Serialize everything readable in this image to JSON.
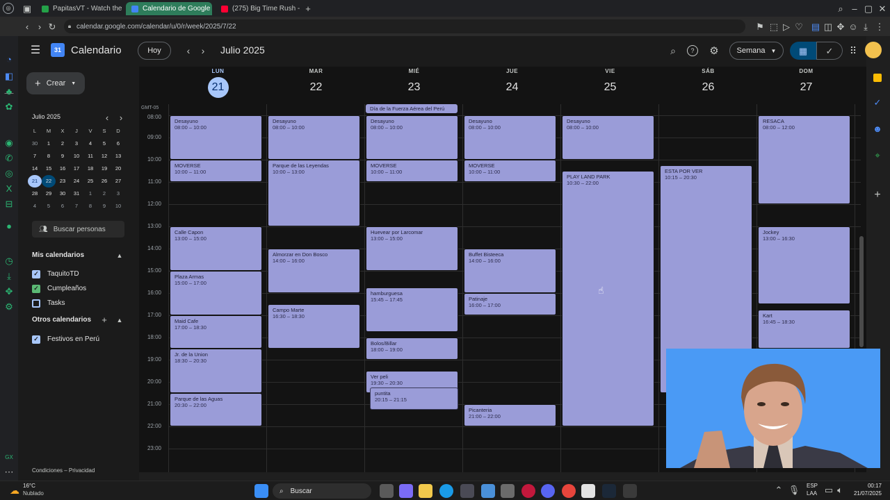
{
  "browser": {
    "tabs": [
      {
        "label": "PapitasVT - Watch the VO"
      },
      {
        "label": "Calendario de Google - S"
      },
      {
        "label": "(275) Big Time Rush -"
      }
    ],
    "url": "calendar.google.com/calendar/u/0/r/week/2025/7/22"
  },
  "header": {
    "app_name": "Calendario",
    "today_button": "Hoy",
    "period": "Julio 2025",
    "view_select": "Semana"
  },
  "sidebar": {
    "create_button": "Crear",
    "mini_month": "Julio 2025",
    "weekday_letters": [
      "L",
      "M",
      "X",
      "J",
      "V",
      "S",
      "D"
    ],
    "weeks": [
      [
        "30",
        "1",
        "2",
        "3",
        "4",
        "5",
        "6"
      ],
      [
        "7",
        "8",
        "9",
        "10",
        "11",
        "12",
        "13"
      ],
      [
        "14",
        "15",
        "16",
        "17",
        "18",
        "19",
        "20"
      ],
      [
        "21",
        "22",
        "23",
        "24",
        "25",
        "26",
        "27"
      ],
      [
        "28",
        "29",
        "30",
        "31",
        "1",
        "2",
        "3"
      ],
      [
        "4",
        "5",
        "6",
        "7",
        "8",
        "9",
        "10"
      ]
    ],
    "search_people": "Buscar personas",
    "my_calendars_title": "Mis calendarios",
    "my_calendars": [
      {
        "label": "TaquitoTD",
        "color": "#a8c7fa",
        "checked": "✓"
      },
      {
        "label": "Cumpleaños",
        "color": "#5bb974",
        "checked": "✓"
      },
      {
        "label": "Tasks",
        "color": "#a8c7fa",
        "checked": ""
      }
    ],
    "other_calendars_title": "Otros calendarios",
    "other_calendars": [
      {
        "label": "Festivos en Perú",
        "color": "#a8c7fa",
        "checked": "✓"
      }
    ],
    "footer": "Condiciones – Privacidad"
  },
  "week": {
    "timezone": "GMT-05",
    "days": [
      {
        "name": "LUN",
        "num": "21"
      },
      {
        "name": "MAR",
        "num": "22"
      },
      {
        "name": "MIÉ",
        "num": "23"
      },
      {
        "name": "JUE",
        "num": "24"
      },
      {
        "name": "VIE",
        "num": "25"
      },
      {
        "name": "SÁB",
        "num": "26"
      },
      {
        "name": "DOM",
        "num": "27"
      }
    ],
    "hours": [
      "08:00",
      "09:00",
      "10:00",
      "11:00",
      "12:00",
      "13:00",
      "14:00",
      "15:00",
      "16:00",
      "17:00",
      "18:00",
      "19:00",
      "20:00",
      "21:00",
      "22:00",
      "23:00"
    ],
    "allday_event": "Día de la Fuerza Aérea del Perú",
    "events": [
      {
        "day": 0,
        "title": "Desayuno",
        "time": "08:00 – 10:00",
        "start": 8,
        "end": 10
      },
      {
        "day": 0,
        "title": "MOVERSE",
        "time": "10:00 – 11:00",
        "start": 10,
        "end": 11
      },
      {
        "day": 0,
        "title": "Calle Capon",
        "time": "13:00 – 15:00",
        "start": 13,
        "end": 15
      },
      {
        "day": 0,
        "title": "Plaza Armas",
        "time": "15:00 – 17:00",
        "start": 15,
        "end": 17
      },
      {
        "day": 0,
        "title": "Maid Cafe",
        "time": "17:00 – 18:30",
        "start": 17,
        "end": 18.5
      },
      {
        "day": 0,
        "title": "Jr. de la Union",
        "time": "18:30 – 20:30",
        "start": 18.5,
        "end": 20.5
      },
      {
        "day": 0,
        "title": "Parque de las Aguas",
        "time": "20:30 – 22:00",
        "start": 20.5,
        "end": 22
      },
      {
        "day": 1,
        "title": "Desayuno",
        "time": "08:00 – 10:00",
        "start": 8,
        "end": 10
      },
      {
        "day": 1,
        "title": "Parque de las Leyendas",
        "time": "10:00 – 13:00",
        "start": 10,
        "end": 13
      },
      {
        "day": 1,
        "title": "Almorzar en Don Bosco",
        "time": "14:00 – 16:00",
        "start": 14,
        "end": 16
      },
      {
        "day": 1,
        "title": "Campo Marte",
        "time": "16:30 – 18:30",
        "start": 16.5,
        "end": 18.5
      },
      {
        "day": 2,
        "title": "Desayuno",
        "time": "08:00 – 10:00",
        "start": 8,
        "end": 10
      },
      {
        "day": 2,
        "title": "MOVERSE",
        "time": "10:00 – 11:00",
        "start": 10,
        "end": 11
      },
      {
        "day": 2,
        "title": "Huevear por Larcomar",
        "time": "13:00 – 15:00",
        "start": 13,
        "end": 15
      },
      {
        "day": 2,
        "title": "hamburguesa",
        "time": "15:45 – 17:45",
        "start": 15.75,
        "end": 17.75
      },
      {
        "day": 2,
        "title": "Bolos/Billar",
        "time": "18:00 – 19:00",
        "start": 18,
        "end": 19
      },
      {
        "day": 2,
        "title": "Ver peli",
        "time": "19:30 – 20:30",
        "start": 19.5,
        "end": 20.5
      },
      {
        "day": 2,
        "title": "puntita",
        "time": "20:15 – 21:15",
        "start": 20.25,
        "end": 21.25,
        "indent": 1
      },
      {
        "day": 3,
        "title": "Desayuno",
        "time": "08:00 – 10:00",
        "start": 8,
        "end": 10
      },
      {
        "day": 3,
        "title": "MOVERSE",
        "time": "10:00 – 11:00",
        "start": 10,
        "end": 11
      },
      {
        "day": 3,
        "title": "Buffet Bisteeca",
        "time": "14:00 – 16:00",
        "start": 14,
        "end": 16
      },
      {
        "day": 3,
        "title": "Patinaje",
        "time": "16:00 – 17:00",
        "start": 16,
        "end": 17
      },
      {
        "day": 3,
        "title": "Picanteria",
        "time": "21:00 – 22:00",
        "start": 21,
        "end": 22
      },
      {
        "day": 4,
        "title": "Desayuno",
        "time": "08:00 – 10:00",
        "start": 8,
        "end": 10
      },
      {
        "day": 4,
        "title": "PLAY LAND PARK",
        "time": "10:30 – 22:00",
        "start": 10.5,
        "end": 22
      },
      {
        "day": 5,
        "title": "ESTA POR VER",
        "time": "10:15 – 20:30",
        "start": 10.25,
        "end": 20.5
      },
      {
        "day": 6,
        "title": "RESACA",
        "time": "08:00 – 12:00",
        "start": 8,
        "end": 12
      },
      {
        "day": 6,
        "title": "Jockey",
        "time": "13:00 – 16:30",
        "start": 13,
        "end": 16.5
      },
      {
        "day": 6,
        "title": "Kart",
        "time": "16:45 – 18:30",
        "start": 16.75,
        "end": 18.5
      }
    ]
  },
  "taskbar": {
    "temp": "16°C",
    "weather": "Nublado",
    "search": "Buscar",
    "lang": "ESP",
    "lang2": "LAA",
    "time": "00:17",
    "date": "21/07/2025"
  }
}
